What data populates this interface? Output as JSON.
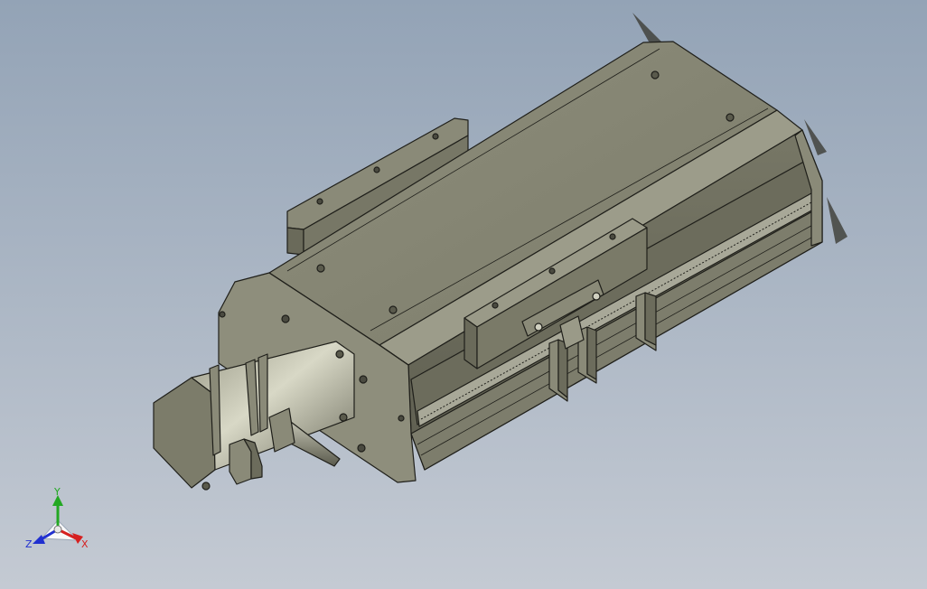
{
  "viewport": {
    "background_top": "#93a3b6",
    "background_bottom": "#c4cad3",
    "model_color": "#8a8a78",
    "edge_color": "#1f1f1a"
  },
  "triad": {
    "x_label": "X",
    "y_label": "Y",
    "z_label": "Z",
    "x_color": "#d62020",
    "y_color": "#22a822",
    "z_color": "#2030d0"
  }
}
